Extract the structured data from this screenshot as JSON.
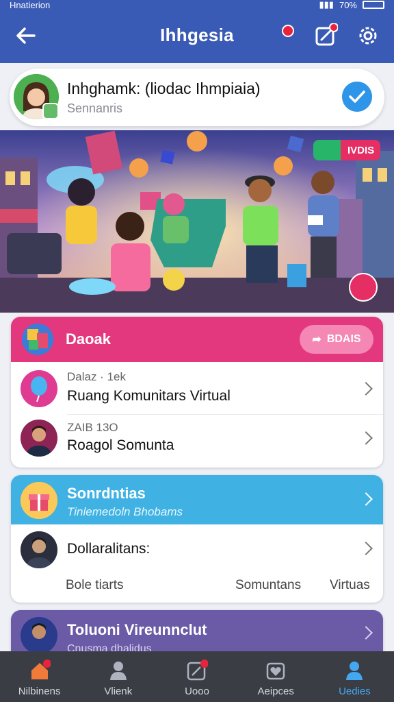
{
  "status": {
    "carrier": "Hnatierion",
    "battery": "70%"
  },
  "header": {
    "title": "Ihhgesia"
  },
  "profile": {
    "name": "Inhghamk:  (liodac Ihmpiaia)",
    "subtitle": "Sennanris"
  },
  "banner": {
    "tag": "IVDIS"
  },
  "card1": {
    "title": "Daoak",
    "action": "BDAIS",
    "rows": [
      {
        "meta": "Dalaz · 1ek",
        "title": "Ruang Komunitars Virtual"
      },
      {
        "meta": "ZAIB 13O",
        "title": "Roagol Somunta"
      }
    ]
  },
  "card2": {
    "title": "Sonrdntias",
    "subtitle": "Tinlemedoln Bhobams",
    "row": {
      "title": "Dollaralitans:"
    },
    "footer": [
      "Bole tiarts",
      "Somuntans",
      "Virtuas"
    ]
  },
  "card3": {
    "title": "Toluoni Vireunnclut",
    "subtitle": "Cnusma dhalidus"
  },
  "tabs": [
    {
      "label": "Nilbinens",
      "icon": "home-icon"
    },
    {
      "label": "Vlienk",
      "icon": "person-icon"
    },
    {
      "label": "Uooo",
      "icon": "edit-icon"
    },
    {
      "label": "Aeipces",
      "icon": "heart-icon"
    },
    {
      "label": "Uedies",
      "icon": "profile-icon"
    }
  ],
  "colors": {
    "primary": "#3a5bb5",
    "pink": "#e3387d",
    "blue": "#3fb2e3",
    "purple": "#6b5aa6",
    "tabbar": "#3b3d45",
    "active_tab": "#43a8f0"
  }
}
